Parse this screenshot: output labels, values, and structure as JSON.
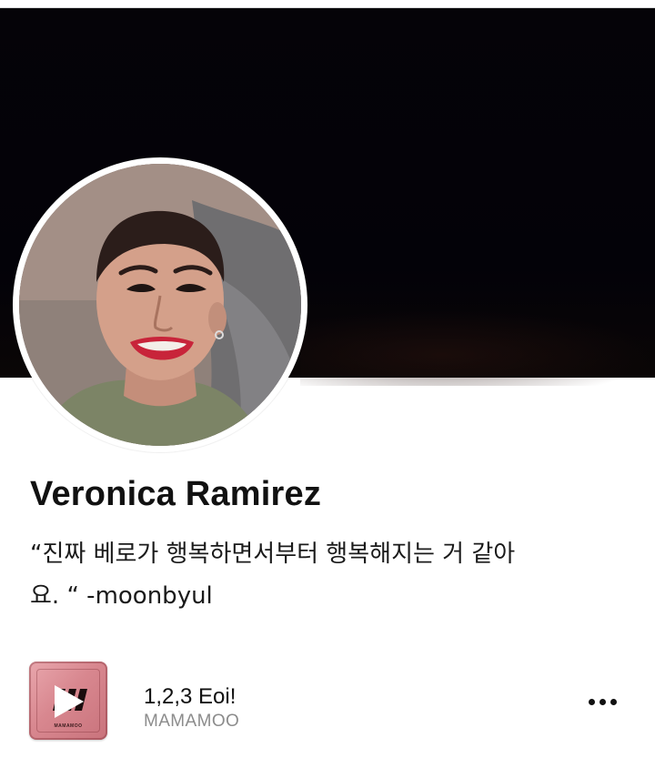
{
  "profile": {
    "name": "Veronica Ramirez",
    "bio_line1": "“진짜 베로가 행복하면서부터 행복해지는 거 같아",
    "bio_line2": "요. “ -moonbyul"
  },
  "song": {
    "title": "1,2,3 Eoi!",
    "artist": "MAMAMOO",
    "album_caption": "MAMAMOO",
    "album_color": "#d8878f"
  },
  "icons": {
    "play": "play-icon",
    "more": "more-options-icon"
  }
}
